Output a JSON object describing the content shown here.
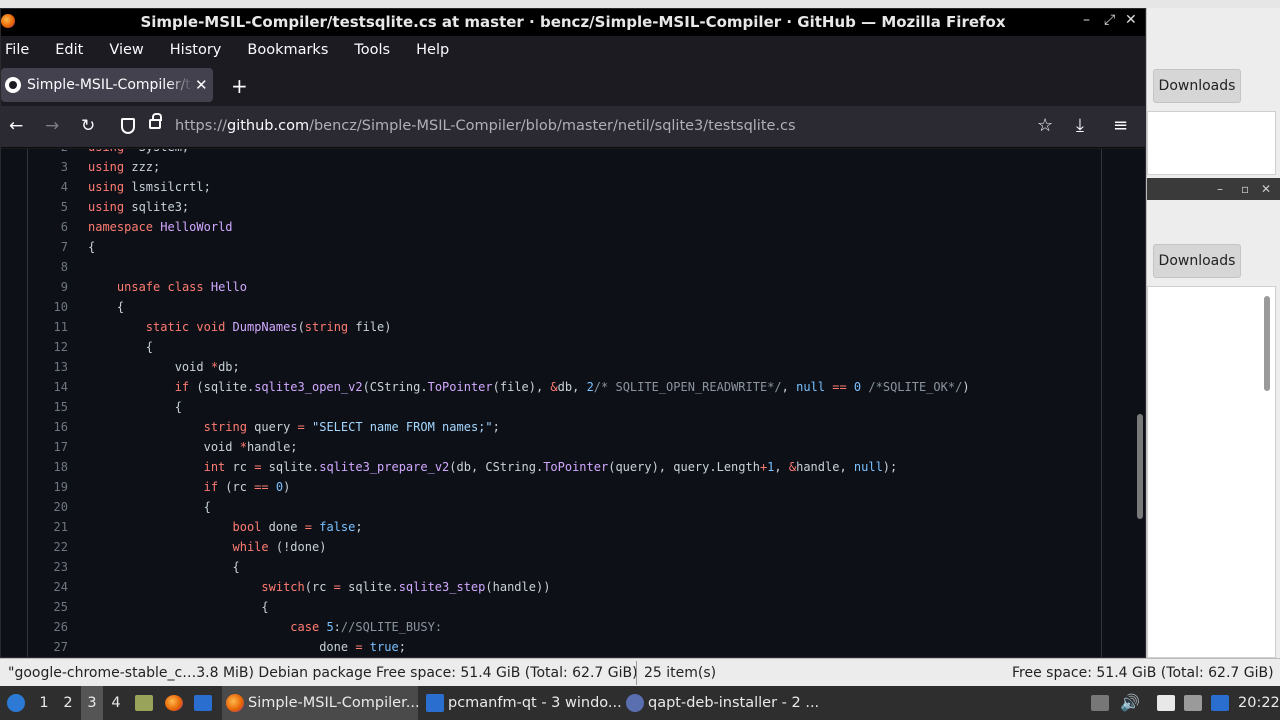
{
  "window": {
    "title": "Simple-MSIL-Compiler/testsqlite.cs at master · bencz/Simple-MSIL-Compiler · GitHub — Mozilla Firefox",
    "controls": [
      "–",
      "⤢",
      "✕"
    ]
  },
  "menu": [
    "File",
    "Edit",
    "View",
    "History",
    "Bookmarks",
    "Tools",
    "Help"
  ],
  "tab": {
    "label": "Simple-MSIL-Compiler/testsqlite.cs",
    "close": "✕",
    "newtab": "+"
  },
  "nav": {
    "back": "←",
    "forward": "→",
    "reload": "↻",
    "url_prefix": "https://",
    "url_host": "github.com",
    "url_path": "/bencz/Simple-MSIL-Compiler/blob/master/netil/sqlite3/testsqlite.cs",
    "bookmark": "☆",
    "download": "⤓",
    "menu": "≡"
  },
  "code": [
    {
      "n": "2",
      "t": [
        [
          "kw",
          "using"
        ],
        [
          "",
          "  System;"
        ]
      ]
    },
    {
      "n": "3",
      "t": [
        [
          "kw",
          "using"
        ],
        [
          "",
          " zzz;"
        ]
      ]
    },
    {
      "n": "4",
      "t": [
        [
          "kw",
          "using"
        ],
        [
          "",
          " lsmsilcrtl;"
        ]
      ]
    },
    {
      "n": "5",
      "t": [
        [
          "kw",
          "using"
        ],
        [
          "",
          " sqlite3;"
        ]
      ]
    },
    {
      "n": "6",
      "t": [
        [
          "kw",
          "namespace"
        ],
        [
          "",
          " "
        ],
        [
          "ty",
          "HelloWorld"
        ]
      ]
    },
    {
      "n": "7",
      "t": [
        [
          "",
          "{"
        ]
      ]
    },
    {
      "n": "8",
      "t": [
        [
          "",
          ""
        ]
      ]
    },
    {
      "n": "9",
      "t": [
        [
          "",
          "    "
        ],
        [
          "kw",
          "unsafe"
        ],
        [
          "",
          " "
        ],
        [
          "kw",
          "class"
        ],
        [
          "",
          " "
        ],
        [
          "ty",
          "Hello"
        ]
      ]
    },
    {
      "n": "10",
      "t": [
        [
          "",
          "    {"
        ]
      ]
    },
    {
      "n": "11",
      "t": [
        [
          "",
          "        "
        ],
        [
          "kw",
          "static"
        ],
        [
          "",
          " "
        ],
        [
          "kw",
          "void"
        ],
        [
          "",
          " "
        ],
        [
          "fn",
          "DumpNames"
        ],
        [
          "",
          "("
        ],
        [
          "kw",
          "string"
        ],
        [
          "",
          " file)"
        ]
      ]
    },
    {
      "n": "12",
      "t": [
        [
          "",
          "        {"
        ]
      ]
    },
    {
      "n": "13",
      "t": [
        [
          "",
          "            void "
        ],
        [
          "kw",
          "*"
        ],
        [
          "",
          "db;"
        ]
      ]
    },
    {
      "n": "14",
      "t": [
        [
          "",
          "            "
        ],
        [
          "kw",
          "if"
        ],
        [
          "",
          " (sqlite."
        ],
        [
          "fn",
          "sqlite3_open_v2"
        ],
        [
          "",
          "(CString."
        ],
        [
          "fn",
          "ToPointer"
        ],
        [
          "",
          "(file), "
        ],
        [
          "kw",
          "&"
        ],
        [
          "",
          "db, "
        ],
        [
          "nu",
          "2"
        ],
        [
          "cm",
          "/* SQLITE_OPEN_READWRITE*/"
        ],
        [
          "",
          ", "
        ],
        [
          "nu",
          "null"
        ],
        [
          "",
          " "
        ],
        [
          "kw",
          "=="
        ],
        [
          "",
          " "
        ],
        [
          "nu",
          "0"
        ],
        [
          "",
          " "
        ],
        [
          "cm",
          "/*SQLITE_OK*/"
        ],
        [
          "",
          ")"
        ]
      ]
    },
    {
      "n": "15",
      "t": [
        [
          "",
          "            {"
        ]
      ]
    },
    {
      "n": "16",
      "t": [
        [
          "",
          "                "
        ],
        [
          "kw",
          "string"
        ],
        [
          "",
          " query "
        ],
        [
          "kw",
          "="
        ],
        [
          "",
          " "
        ],
        [
          "st",
          "\"SELECT name FROM names;\""
        ],
        [
          "",
          ";"
        ]
      ]
    },
    {
      "n": "17",
      "t": [
        [
          "",
          "                void "
        ],
        [
          "kw",
          "*"
        ],
        [
          "",
          "handle;"
        ]
      ]
    },
    {
      "n": "18",
      "t": [
        [
          "",
          "                "
        ],
        [
          "kw",
          "int"
        ],
        [
          "",
          " rc "
        ],
        [
          "kw",
          "="
        ],
        [
          "",
          " sqlite."
        ],
        [
          "fn",
          "sqlite3_prepare_v2"
        ],
        [
          "",
          "(db, CString."
        ],
        [
          "fn",
          "ToPointer"
        ],
        [
          "",
          "(query), query.Length"
        ],
        [
          "kw",
          "+"
        ],
        [
          "nu",
          "1"
        ],
        [
          "",
          ", "
        ],
        [
          "kw",
          "&"
        ],
        [
          "",
          "handle, "
        ],
        [
          "nu",
          "null"
        ],
        [
          "",
          ");"
        ]
      ]
    },
    {
      "n": "19",
      "t": [
        [
          "",
          "                "
        ],
        [
          "kw",
          "if"
        ],
        [
          "",
          " (rc "
        ],
        [
          "kw",
          "=="
        ],
        [
          "",
          " "
        ],
        [
          "nu",
          "0"
        ],
        [
          "",
          ")"
        ]
      ]
    },
    {
      "n": "20",
      "t": [
        [
          "",
          "                {"
        ]
      ]
    },
    {
      "n": "21",
      "t": [
        [
          "",
          "                    "
        ],
        [
          "kw",
          "bool"
        ],
        [
          "",
          " done "
        ],
        [
          "kw",
          "="
        ],
        [
          "",
          " "
        ],
        [
          "nu",
          "false"
        ],
        [
          "",
          ";"
        ]
      ]
    },
    {
      "n": "22",
      "t": [
        [
          "",
          "                    "
        ],
        [
          "kw",
          "while"
        ],
        [
          "",
          " (!done)"
        ]
      ]
    },
    {
      "n": "23",
      "t": [
        [
          "",
          "                    {"
        ]
      ]
    },
    {
      "n": "24",
      "t": [
        [
          "",
          "                        "
        ],
        [
          "kw",
          "switch"
        ],
        [
          "",
          "(rc "
        ],
        [
          "kw",
          "="
        ],
        [
          "",
          " sqlite."
        ],
        [
          "fn",
          "sqlite3_step"
        ],
        [
          "",
          "(handle))"
        ]
      ]
    },
    {
      "n": "25",
      "t": [
        [
          "",
          "                        {"
        ]
      ]
    },
    {
      "n": "26",
      "t": [
        [
          "",
          "                            "
        ],
        [
          "kw",
          "case"
        ],
        [
          "",
          " "
        ],
        [
          "nu",
          "5"
        ],
        [
          "",
          ":"
        ],
        [
          "cm",
          "//SQLITE_BUSY:"
        ]
      ]
    },
    {
      "n": "27",
      "t": [
        [
          "",
          "                                done "
        ],
        [
          "kw",
          "="
        ],
        [
          "",
          " "
        ],
        [
          "nu",
          "true"
        ],
        [
          "",
          ";"
        ]
      ]
    }
  ],
  "bg": {
    "downloads_label": "Downloads"
  },
  "statusbar": {
    "left": "\"google-chrome-stable_c…3.8 MiB) Debian package",
    "free1": "Free space: 51.4 GiB (Total: 62.7 GiB)",
    "items": "25 item(s)",
    "free2": "Free space: 51.4 GiB (Total: 62.7 GiB)"
  },
  "taskbar": {
    "workspaces": [
      "1",
      "2",
      "3",
      "4"
    ],
    "tasks": [
      "Simple-MSIL-Compiler...",
      "pcmanfm-qt - 3 windo...",
      "qapt-deb-installer - 2 ..."
    ],
    "clock": "20:22"
  }
}
